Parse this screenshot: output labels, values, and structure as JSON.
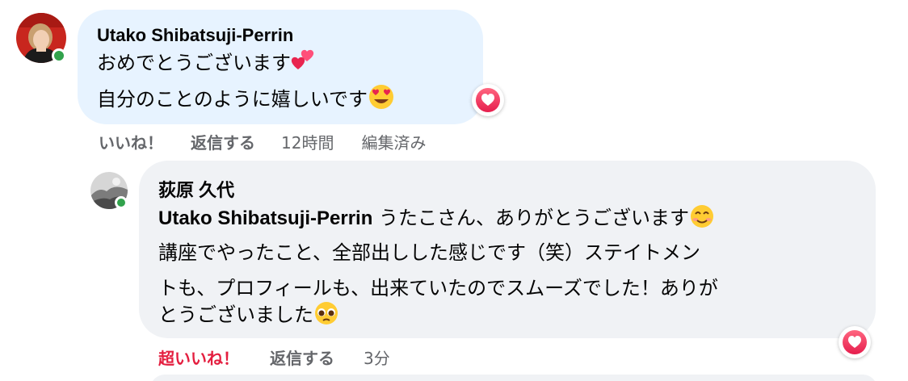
{
  "comment": {
    "author": "Utako Shibatsuji-Perrin",
    "line1": "おめでとうございます",
    "line1_emoji": "two-hearts-emoji",
    "line2": "自分のことのように嬉しいです",
    "line2_emoji": "heart-eyes-emoji",
    "reaction": "love",
    "actions": {
      "like": "いいね！",
      "reply": "返信する",
      "time": "12時間",
      "edited": "編集済み"
    },
    "colors": {
      "bubble": "#e7f3ff"
    }
  },
  "reply": {
    "author": "荻原 久代",
    "mention": "Utako Shibatsuji-Perrin",
    "line1_rest": " うたこさん、ありがとうございます",
    "line1_emoji": "smiling-face-emoji",
    "line2": "講座でやったこと、全部出しした感じです（笑）ステイトメン",
    "line3": "トも、プロフィールも、出来ていたのでスムーズでした！ありが",
    "line4": "とうございました",
    "line4_emoji": "pleading-face-emoji",
    "reaction": "love",
    "actions": {
      "like": "超いいね！",
      "reply": "返信する",
      "time": "3分"
    },
    "colors": {
      "bubble": "#f0f2f5",
      "like_active": "#e41e3f"
    }
  }
}
